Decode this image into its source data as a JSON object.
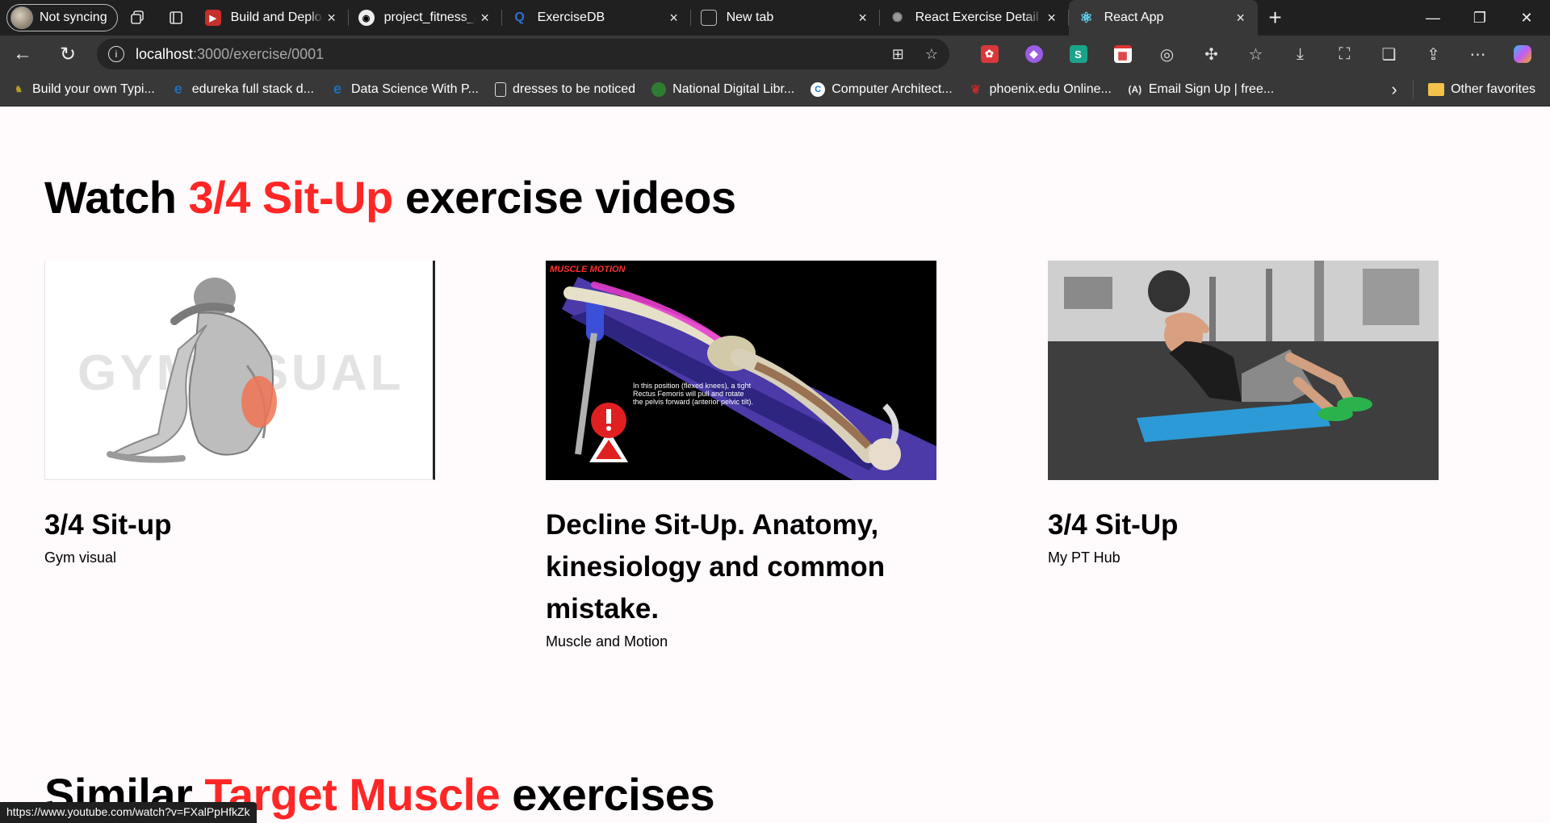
{
  "browser": {
    "profile_label": "Not syncing",
    "tabs": [
      {
        "title": "Build and Deploy a Mod",
        "favicon": "youtube-icon",
        "color": "#c4302b"
      },
      {
        "title": "project_fitness_app/src/",
        "favicon": "github-icon",
        "color": "#eeeeee"
      },
      {
        "title": "ExerciseDB",
        "favicon": "exercisedb-icon",
        "color": "#2f6fd6"
      },
      {
        "title": "New tab",
        "favicon": "newtab-icon",
        "color": "#bbbbbb"
      },
      {
        "title": "React Exercise Detail De",
        "favicon": "chatgpt-icon",
        "color": "#999999"
      },
      {
        "title": "React App",
        "favicon": "react-icon",
        "color": "#61dafb",
        "active": true
      }
    ],
    "address": {
      "host": "localhost",
      "path": ":3000/exercise/0001"
    },
    "favorites": [
      {
        "label": "Build your own Typi...",
        "icon": "bookmark-site-icon",
        "color": "#b59b2a"
      },
      {
        "label": "edureka full stack d...",
        "icon": "edureka-icon",
        "color": "#1f6fb7"
      },
      {
        "label": "Data Science With P...",
        "icon": "edureka-icon",
        "color": "#1f6fb7"
      },
      {
        "label": "dresses to be noticed",
        "icon": "document-icon",
        "color": "#dddddd"
      },
      {
        "label": "National Digital Libr...",
        "icon": "ndl-icon",
        "color": "#2e7d32"
      },
      {
        "label": "Computer Architect...",
        "icon": "coursera-icon",
        "color": "#1a73e8"
      },
      {
        "label": "phoenix.edu Online...",
        "icon": "phoenix-icon",
        "color": "#c62828"
      },
      {
        "label": "Email Sign Up | free...",
        "icon": "angular-icon",
        "color": "#eeeeee"
      }
    ],
    "other_favorites": "Other favorites",
    "status_url": "https://www.youtube.com/watch?v=FXalPpHfkZk"
  },
  "page": {
    "videos_heading": {
      "prefix": "Watch",
      "accent": "3/4 Sit-Up",
      "suffix": "exercise videos"
    },
    "videos": [
      {
        "title": "3/4 Sit-up",
        "channel": "Gym visual",
        "watermark": "GYMVISUAL"
      },
      {
        "title": "Decline Sit-Up. Anatomy, kinesiology and common mistake.",
        "channel": "Muscle and Motion",
        "logo_text": "MUSCLE MOTION",
        "caption_text": "In this position (flexed knees), a tight Rectus Femoris will pull and rotate the pelvis forward (anterior pelvic tilt)."
      },
      {
        "title": "3/4 Sit-Up",
        "channel": "My PT Hub"
      }
    ],
    "similar_heading": {
      "prefix": "Similar",
      "accent": "Target Muscle",
      "suffix": "exercises"
    }
  },
  "colors": {
    "accent": "#ff2625",
    "page_bg": "#fffafb",
    "chrome_dark": "#202020",
    "chrome": "#383838"
  }
}
